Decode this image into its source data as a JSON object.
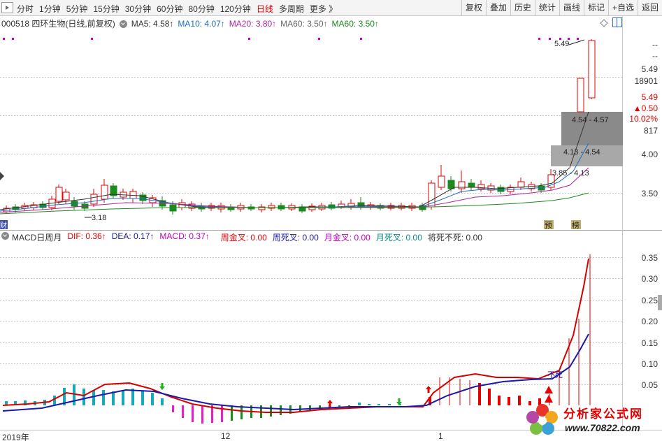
{
  "toolbar": {
    "periods": [
      "分时",
      "1分钟",
      "5分钟",
      "15分钟",
      "30分钟",
      "60分钟",
      "80分钟",
      "120分钟",
      "日线",
      "多周期",
      "更多 》"
    ],
    "active_period": "日线",
    "tools": [
      "复权",
      "叠加",
      "历史",
      "统计",
      "画线",
      "标记",
      "+自选",
      "返回"
    ]
  },
  "stock": {
    "code_name": "000518 四环生物(日线,前复权)",
    "ma": [
      {
        "label": "MA5: 4.58↑",
        "color": "#333333"
      },
      {
        "label": "MA10: 4.07↑",
        "color": "#1a6fbf"
      },
      {
        "label": "MA20: 3.80↑",
        "color": "#b0249c"
      },
      {
        "label": "MA60: 3.50↑",
        "color": "#666666"
      },
      {
        "label": "MA60: 3.50↑",
        "color": "#1d8a1d"
      }
    ]
  },
  "price_axis": {
    "labels": [
      "--",
      "--",
      "5.49",
      "18901",
      "5.49",
      "▲0.50",
      "10.02%",
      "817",
      "4.00",
      "3.50"
    ]
  },
  "price_annotations": {
    "high": "5.49",
    "low": "3.18",
    "zone1": "4.54 - 4.57",
    "zone2": "4.13 - 4.54",
    "zone3": "3.85 - 4.13",
    "bottom_marks": [
      "财",
      "预",
      "榜"
    ]
  },
  "macd": {
    "title": "MACD日周月",
    "dif": "DIF: 0.36↑",
    "dea": "DEA: 0.17↑",
    "macd": "MACD: 0.37↑",
    "week_gold": "周金叉: 0.00",
    "week_dead": "周死叉: 0.00",
    "month_gold": "月金叉: 0.00",
    "month_dead": "月死叉: 0.00",
    "never_die": "将死不死: 0.00",
    "axis": [
      "0.35",
      "0.30",
      "0.25",
      "0.20",
      "0.15",
      "0.10",
      "0.05"
    ],
    "annotation": "不死"
  },
  "time_axis": {
    "labels": [
      "2019年",
      "12",
      "1"
    ]
  },
  "watermark": {
    "title": "分析家公式网",
    "url": "www.70822.com"
  },
  "colors": {
    "up": "#e60000",
    "down": "#1d8a1d",
    "dif": "#d40000",
    "dea": "#1a1aa8",
    "ma_gray": "#666666"
  }
}
